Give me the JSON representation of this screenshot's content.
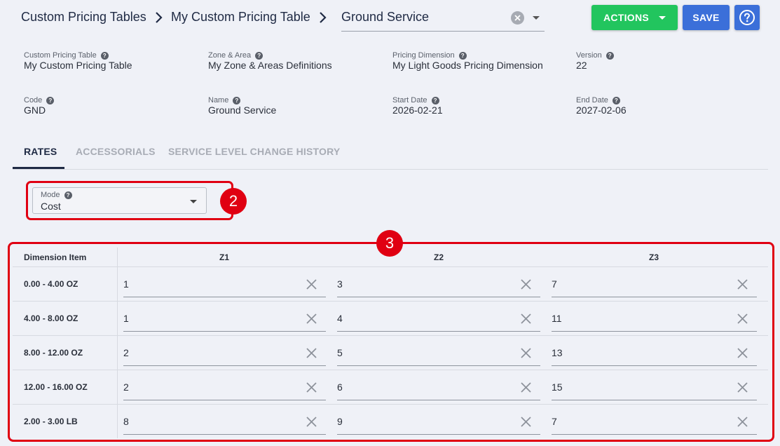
{
  "breadcrumb": {
    "items": [
      "Custom Pricing Tables",
      "My Custom Pricing Table"
    ],
    "current": "Ground Service"
  },
  "toolbar": {
    "actions_label": "ACTIONS",
    "save_label": "SAVE",
    "help_icon": "help-circle-icon"
  },
  "info": {
    "custom_pricing_table": {
      "label": "Custom Pricing Table",
      "value": "My Custom Pricing Table"
    },
    "zone_area": {
      "label": "Zone & Area",
      "value": "My Zone & Areas Definitions"
    },
    "pricing_dimension": {
      "label": "Pricing Dimension",
      "value": "My Light Goods Pricing Dimension"
    },
    "version": {
      "label": "Version",
      "value": "22"
    },
    "code": {
      "label": "Code",
      "value": "GND"
    },
    "name": {
      "label": "Name",
      "value": "Ground Service"
    },
    "start_date": {
      "label": "Start Date",
      "value": "2026-02-21"
    },
    "end_date": {
      "label": "End Date",
      "value": "2027-02-06"
    }
  },
  "tabs": [
    {
      "label": "RATES",
      "active": true
    },
    {
      "label": "ACCESSORIALS",
      "active": false
    },
    {
      "label": "SERVICE LEVEL CHANGE HISTORY",
      "active": false
    }
  ],
  "mode": {
    "label": "Mode",
    "value": "Cost"
  },
  "annotations": {
    "badge_2": "2",
    "badge_3": "3",
    "color": "#e00012"
  },
  "rates_table": {
    "header_label": "Dimension Item",
    "columns": [
      "Z1",
      "Z2",
      "Z3"
    ],
    "rows": [
      {
        "label": "0.00 - 4.00 OZ",
        "values": [
          "1",
          "3",
          "7"
        ]
      },
      {
        "label": "4.00 - 8.00 OZ",
        "values": [
          "1",
          "4",
          "11"
        ]
      },
      {
        "label": "8.00 - 12.00 OZ",
        "values": [
          "2",
          "5",
          "13"
        ]
      },
      {
        "label": "12.00 - 16.00 OZ",
        "values": [
          "2",
          "6",
          "15"
        ]
      },
      {
        "label": "2.00 - 3.00 LB",
        "values": [
          "8",
          "9",
          "7"
        ]
      }
    ]
  },
  "colors": {
    "actions": "#22c55e",
    "save": "#3b6fd9",
    "help": "#3b6fd9",
    "background": "#eff1f7"
  }
}
